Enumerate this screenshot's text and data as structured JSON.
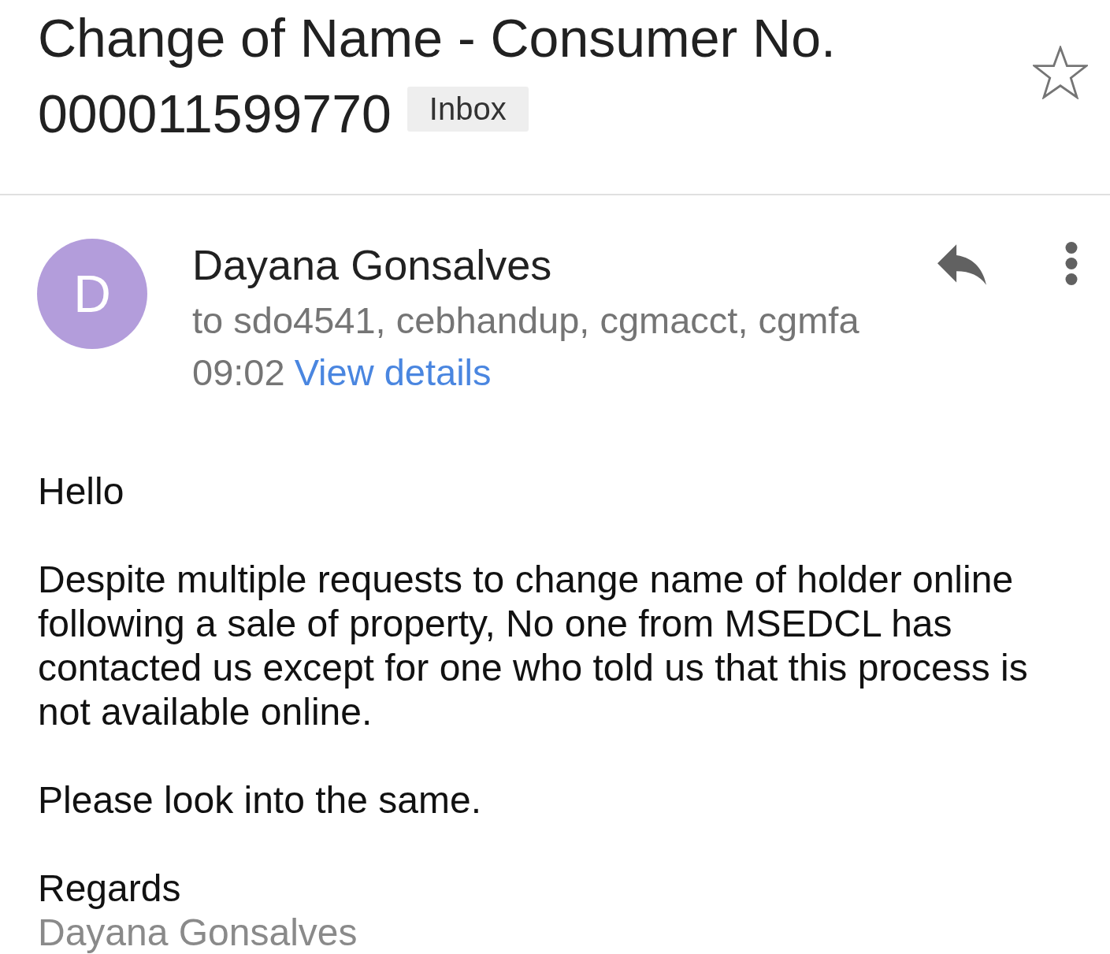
{
  "subject": {
    "title_lines": [
      "Change of Name - Consumer No.",
      "000011599770"
    ],
    "label": "Inbox",
    "starred": false
  },
  "message": {
    "sender": {
      "name": "Dayana Gonsalves",
      "initial": "D"
    },
    "recipients": "to sdo4541, cebhandup, cgmacct, cgmfa",
    "time": "09:02",
    "details_link": "View details"
  },
  "body": {
    "greeting": "Hello",
    "paragraphs": [
      "Despite multiple requests to change name of holder online following a sale of property, No one from MSEDCL has contacted us except for one who told us that this process is not available online.",
      "Please look into the same."
    ],
    "closing": "Regards",
    "signature": "Dayana Gonsalves"
  }
}
